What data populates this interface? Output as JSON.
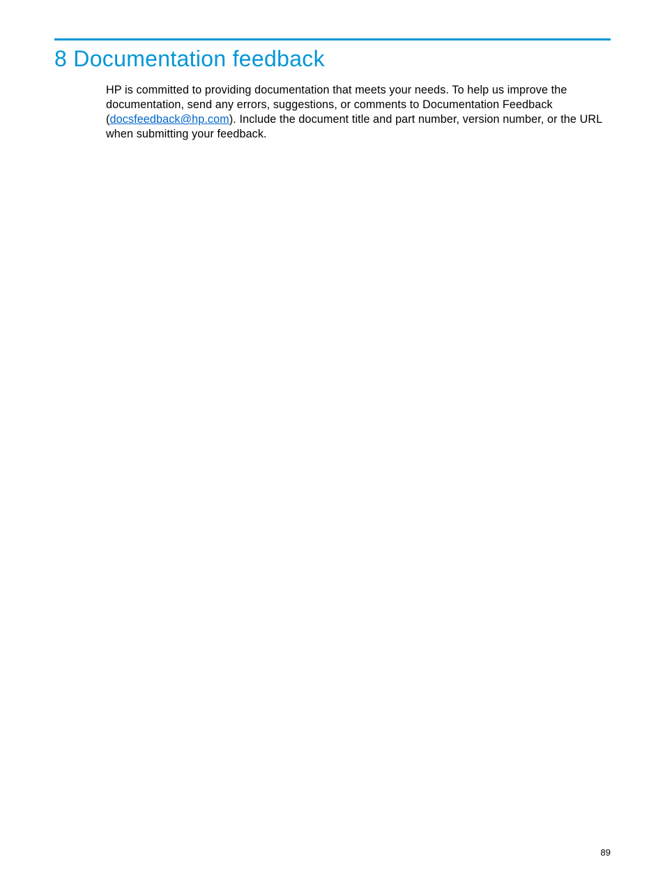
{
  "heading": "8 Documentation feedback",
  "body": {
    "text_before_link": "HP is committed to providing documentation that meets your needs. To help us improve the documentation, send any errors, suggestions, or comments to Documentation Feedback (",
    "email_link": "docsfeedback@hp.com",
    "text_after_link": "). Include the document title and part number, version number, or the URL when submitting your feedback."
  },
  "page_number": "89",
  "colors": {
    "accent": "#0096d6",
    "link": "#0066cc"
  }
}
